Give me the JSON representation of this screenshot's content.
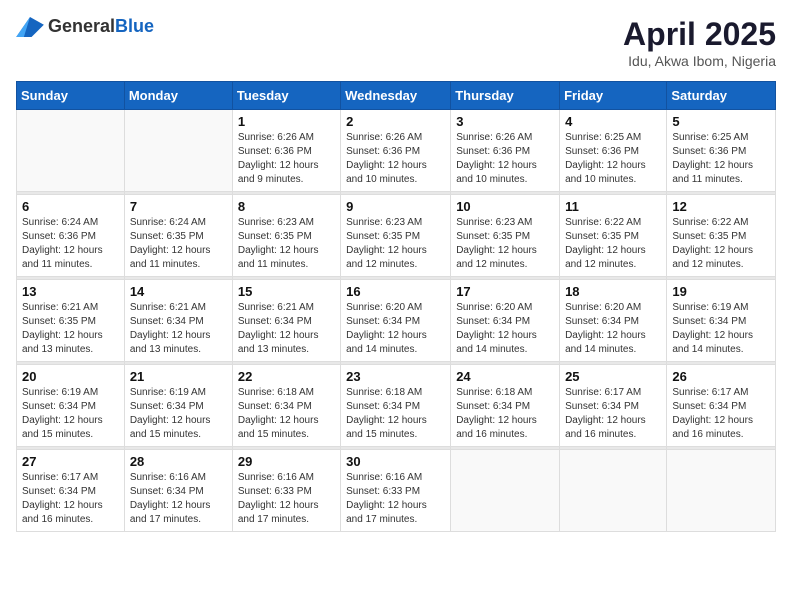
{
  "header": {
    "logo_general": "General",
    "logo_blue": "Blue",
    "month_year": "April 2025",
    "location": "Idu, Akwa Ibom, Nigeria"
  },
  "weekdays": [
    "Sunday",
    "Monday",
    "Tuesday",
    "Wednesday",
    "Thursday",
    "Friday",
    "Saturday"
  ],
  "weeks": [
    [
      {
        "day": "",
        "sunrise": "",
        "sunset": "",
        "daylight": "",
        "empty": true
      },
      {
        "day": "",
        "sunrise": "",
        "sunset": "",
        "daylight": "",
        "empty": true
      },
      {
        "day": "1",
        "sunrise": "Sunrise: 6:26 AM",
        "sunset": "Sunset: 6:36 PM",
        "daylight": "Daylight: 12 hours and 9 minutes.",
        "empty": false
      },
      {
        "day": "2",
        "sunrise": "Sunrise: 6:26 AM",
        "sunset": "Sunset: 6:36 PM",
        "daylight": "Daylight: 12 hours and 10 minutes.",
        "empty": false
      },
      {
        "day": "3",
        "sunrise": "Sunrise: 6:26 AM",
        "sunset": "Sunset: 6:36 PM",
        "daylight": "Daylight: 12 hours and 10 minutes.",
        "empty": false
      },
      {
        "day": "4",
        "sunrise": "Sunrise: 6:25 AM",
        "sunset": "Sunset: 6:36 PM",
        "daylight": "Daylight: 12 hours and 10 minutes.",
        "empty": false
      },
      {
        "day": "5",
        "sunrise": "Sunrise: 6:25 AM",
        "sunset": "Sunset: 6:36 PM",
        "daylight": "Daylight: 12 hours and 11 minutes.",
        "empty": false
      }
    ],
    [
      {
        "day": "6",
        "sunrise": "Sunrise: 6:24 AM",
        "sunset": "Sunset: 6:36 PM",
        "daylight": "Daylight: 12 hours and 11 minutes.",
        "empty": false
      },
      {
        "day": "7",
        "sunrise": "Sunrise: 6:24 AM",
        "sunset": "Sunset: 6:35 PM",
        "daylight": "Daylight: 12 hours and 11 minutes.",
        "empty": false
      },
      {
        "day": "8",
        "sunrise": "Sunrise: 6:23 AM",
        "sunset": "Sunset: 6:35 PM",
        "daylight": "Daylight: 12 hours and 11 minutes.",
        "empty": false
      },
      {
        "day": "9",
        "sunrise": "Sunrise: 6:23 AM",
        "sunset": "Sunset: 6:35 PM",
        "daylight": "Daylight: 12 hours and 12 minutes.",
        "empty": false
      },
      {
        "day": "10",
        "sunrise": "Sunrise: 6:23 AM",
        "sunset": "Sunset: 6:35 PM",
        "daylight": "Daylight: 12 hours and 12 minutes.",
        "empty": false
      },
      {
        "day": "11",
        "sunrise": "Sunrise: 6:22 AM",
        "sunset": "Sunset: 6:35 PM",
        "daylight": "Daylight: 12 hours and 12 minutes.",
        "empty": false
      },
      {
        "day": "12",
        "sunrise": "Sunrise: 6:22 AM",
        "sunset": "Sunset: 6:35 PM",
        "daylight": "Daylight: 12 hours and 12 minutes.",
        "empty": false
      }
    ],
    [
      {
        "day": "13",
        "sunrise": "Sunrise: 6:21 AM",
        "sunset": "Sunset: 6:35 PM",
        "daylight": "Daylight: 12 hours and 13 minutes.",
        "empty": false
      },
      {
        "day": "14",
        "sunrise": "Sunrise: 6:21 AM",
        "sunset": "Sunset: 6:34 PM",
        "daylight": "Daylight: 12 hours and 13 minutes.",
        "empty": false
      },
      {
        "day": "15",
        "sunrise": "Sunrise: 6:21 AM",
        "sunset": "Sunset: 6:34 PM",
        "daylight": "Daylight: 12 hours and 13 minutes.",
        "empty": false
      },
      {
        "day": "16",
        "sunrise": "Sunrise: 6:20 AM",
        "sunset": "Sunset: 6:34 PM",
        "daylight": "Daylight: 12 hours and 14 minutes.",
        "empty": false
      },
      {
        "day": "17",
        "sunrise": "Sunrise: 6:20 AM",
        "sunset": "Sunset: 6:34 PM",
        "daylight": "Daylight: 12 hours and 14 minutes.",
        "empty": false
      },
      {
        "day": "18",
        "sunrise": "Sunrise: 6:20 AM",
        "sunset": "Sunset: 6:34 PM",
        "daylight": "Daylight: 12 hours and 14 minutes.",
        "empty": false
      },
      {
        "day": "19",
        "sunrise": "Sunrise: 6:19 AM",
        "sunset": "Sunset: 6:34 PM",
        "daylight": "Daylight: 12 hours and 14 minutes.",
        "empty": false
      }
    ],
    [
      {
        "day": "20",
        "sunrise": "Sunrise: 6:19 AM",
        "sunset": "Sunset: 6:34 PM",
        "daylight": "Daylight: 12 hours and 15 minutes.",
        "empty": false
      },
      {
        "day": "21",
        "sunrise": "Sunrise: 6:19 AM",
        "sunset": "Sunset: 6:34 PM",
        "daylight": "Daylight: 12 hours and 15 minutes.",
        "empty": false
      },
      {
        "day": "22",
        "sunrise": "Sunrise: 6:18 AM",
        "sunset": "Sunset: 6:34 PM",
        "daylight": "Daylight: 12 hours and 15 minutes.",
        "empty": false
      },
      {
        "day": "23",
        "sunrise": "Sunrise: 6:18 AM",
        "sunset": "Sunset: 6:34 PM",
        "daylight": "Daylight: 12 hours and 15 minutes.",
        "empty": false
      },
      {
        "day": "24",
        "sunrise": "Sunrise: 6:18 AM",
        "sunset": "Sunset: 6:34 PM",
        "daylight": "Daylight: 12 hours and 16 minutes.",
        "empty": false
      },
      {
        "day": "25",
        "sunrise": "Sunrise: 6:17 AM",
        "sunset": "Sunset: 6:34 PM",
        "daylight": "Daylight: 12 hours and 16 minutes.",
        "empty": false
      },
      {
        "day": "26",
        "sunrise": "Sunrise: 6:17 AM",
        "sunset": "Sunset: 6:34 PM",
        "daylight": "Daylight: 12 hours and 16 minutes.",
        "empty": false
      }
    ],
    [
      {
        "day": "27",
        "sunrise": "Sunrise: 6:17 AM",
        "sunset": "Sunset: 6:34 PM",
        "daylight": "Daylight: 12 hours and 16 minutes.",
        "empty": false
      },
      {
        "day": "28",
        "sunrise": "Sunrise: 6:16 AM",
        "sunset": "Sunset: 6:34 PM",
        "daylight": "Daylight: 12 hours and 17 minutes.",
        "empty": false
      },
      {
        "day": "29",
        "sunrise": "Sunrise: 6:16 AM",
        "sunset": "Sunset: 6:33 PM",
        "daylight": "Daylight: 12 hours and 17 minutes.",
        "empty": false
      },
      {
        "day": "30",
        "sunrise": "Sunrise: 6:16 AM",
        "sunset": "Sunset: 6:33 PM",
        "daylight": "Daylight: 12 hours and 17 minutes.",
        "empty": false
      },
      {
        "day": "",
        "sunrise": "",
        "sunset": "",
        "daylight": "",
        "empty": true
      },
      {
        "day": "",
        "sunrise": "",
        "sunset": "",
        "daylight": "",
        "empty": true
      },
      {
        "day": "",
        "sunrise": "",
        "sunset": "",
        "daylight": "",
        "empty": true
      }
    ]
  ]
}
